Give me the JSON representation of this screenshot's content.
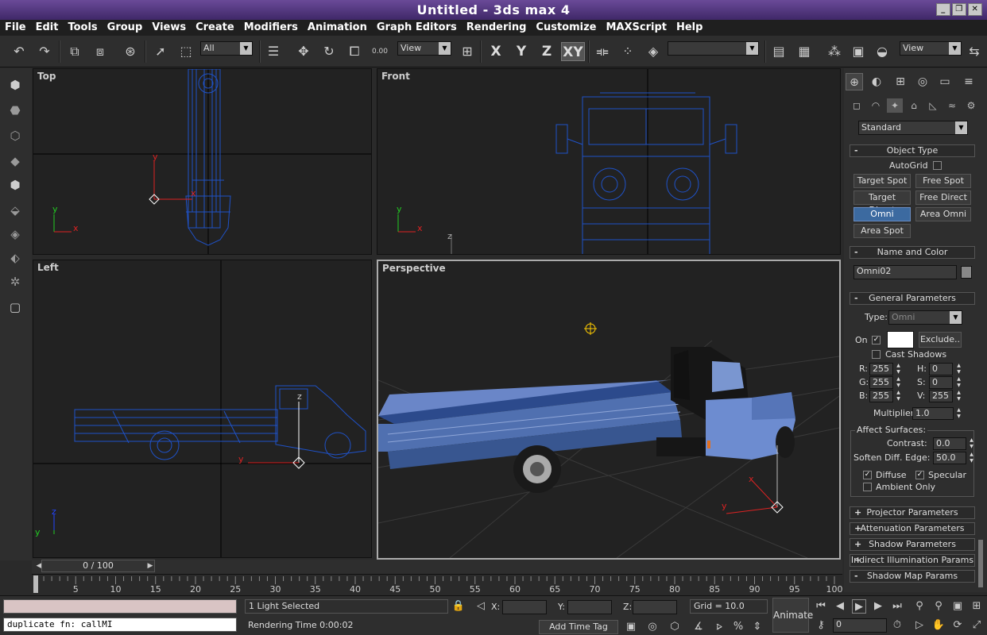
{
  "window": {
    "title": "Untitled - 3ds max 4",
    "buttons": [
      "_",
      "❐",
      "✕"
    ]
  },
  "menu": [
    "File",
    "Edit",
    "Tools",
    "Group",
    "Views",
    "Create",
    "Modifiers",
    "Animation",
    "Graph Editors",
    "Rendering",
    "Customize",
    "MAXScript",
    "Help"
  ],
  "toolbar": {
    "selection_filter": "All",
    "ref_coord": "View",
    "named_sel": "",
    "view_dd": "View",
    "axis_x": "X",
    "axis_y": "Y",
    "axis_z": "Z",
    "axis_xy": "XY",
    "dots": "0.00"
  },
  "viewports": {
    "top": "Top",
    "front": "Front",
    "left": "Left",
    "perspective": "Perspective",
    "axis_x": "x",
    "axis_y": "y",
    "axis_z": "z"
  },
  "command_panel": {
    "category": "Standard",
    "object_type": {
      "title": "Object Type",
      "autogrid": "AutoGrid",
      "buttons": [
        "Target Spot",
        "Free Spot",
        "Target Direct",
        "Free Direct",
        "Omni",
        "Area Omni",
        "Area Spot"
      ]
    },
    "name_color": {
      "title": "Name and Color",
      "name": "Omni02"
    },
    "general": {
      "title": "General Parameters",
      "type_label": "Type:",
      "type_value": "Omni",
      "on_label": "On",
      "exclude": "Exclude..",
      "cast_shadows": "Cast Shadows",
      "r_label": "R:",
      "r": "255",
      "g_label": "G:",
      "g": "255",
      "b_label": "B:",
      "b": "255",
      "h_label": "H:",
      "h": "0",
      "s_label": "S:",
      "s": "0",
      "v_label": "V:",
      "v": "255",
      "multiplier_label": "Multiplier:",
      "multiplier": "1.0",
      "affect_surfaces": "Affect Surfaces:",
      "contrast_label": "Contrast:",
      "contrast": "0.0",
      "soften_label": "Soften Diff. Edge:",
      "soften": "50.0",
      "diffuse": "Diffuse",
      "specular": "Specular",
      "ambient_only": "Ambient Only"
    },
    "rollouts": [
      "Projector Parameters",
      "Attenuation Parameters",
      "Shadow Parameters",
      "Indirect Illumination Params",
      "Shadow Map Params"
    ],
    "colors": {
      "light_color": "#ffffff",
      "accent": "#3c6aa0"
    }
  },
  "time": {
    "slider": "0 / 100",
    "ticks": [
      "0",
      "5",
      "10",
      "15",
      "20",
      "25",
      "30",
      "35",
      "40",
      "45",
      "50",
      "55",
      "60",
      "65",
      "70",
      "75",
      "80",
      "85",
      "90",
      "95",
      "100"
    ]
  },
  "status": {
    "maxscript_top": "",
    "maxscript_line": "duplicate fn: callMI",
    "selection": "1 Light Selected",
    "render_time": "Rendering Time  0:00:02",
    "x_label": "X:",
    "y_label": "Y:",
    "z_label": "Z:",
    "grid": "Grid = 10.0",
    "add_time_tag": "Add Time Tag",
    "animate": "Animate",
    "frame": "0"
  }
}
